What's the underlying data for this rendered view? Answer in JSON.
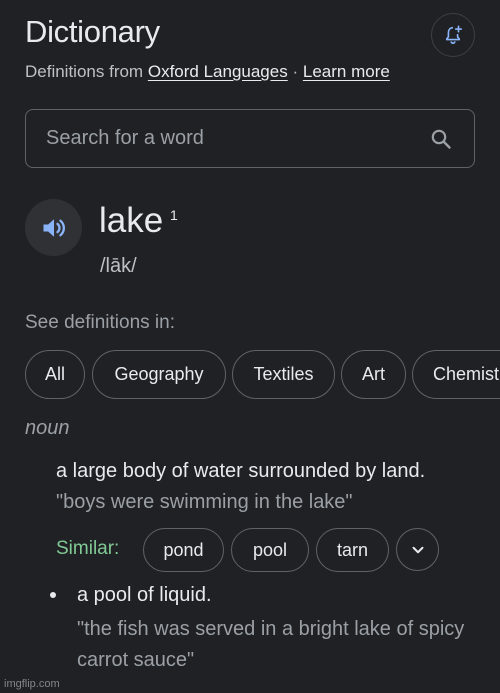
{
  "header": {
    "title": "Dictionary",
    "source_prefix": "Definitions from",
    "source_link": "Oxford Languages",
    "separator": "·",
    "learn_more": "Learn more"
  },
  "search": {
    "placeholder": "Search for a word",
    "value": ""
  },
  "entry": {
    "word": "lake",
    "superscript": "1",
    "phonetic": "/lāk/"
  },
  "see_definitions": {
    "label": "See definitions in:",
    "chips": [
      "All",
      "Geography",
      "Textiles",
      "Art",
      "Chemist"
    ]
  },
  "sense": {
    "part_of_speech": "noun",
    "definition": "a large body of water surrounded by land.",
    "example": "\"boys were swimming in the lake\"",
    "similar_label": "Similar:",
    "similar": [
      "pond",
      "pool",
      "tarn"
    ]
  },
  "sub_sense": {
    "definition": "a pool of liquid.",
    "example": "\"the fish was served in a bright lake of spicy carrot sauce\""
  },
  "watermark": "imgflip.com",
  "colors": {
    "background": "#202124",
    "text": "#e8eaed",
    "muted": "#9aa0a6",
    "similar_label": "#81c995",
    "speaker_icon": "#8ab4f8",
    "border": "#5f6368"
  },
  "icons": {
    "bell": "bell-plus-icon",
    "search": "search-icon",
    "speaker": "speaker-icon",
    "expand": "chevron-down-icon"
  }
}
